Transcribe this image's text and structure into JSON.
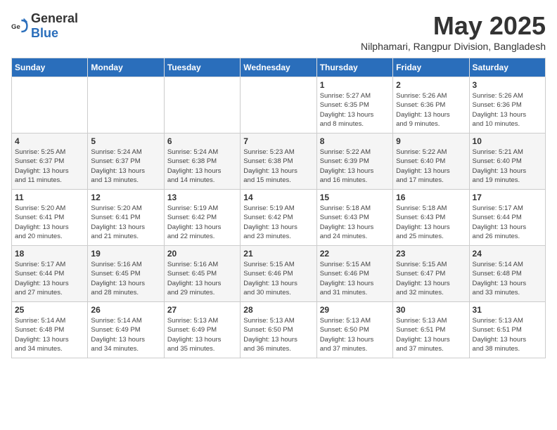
{
  "logo": {
    "general": "General",
    "blue": "Blue"
  },
  "title": "May 2025",
  "subtitle": "Nilphamari, Rangpur Division, Bangladesh",
  "weekdays": [
    "Sunday",
    "Monday",
    "Tuesday",
    "Wednesday",
    "Thursday",
    "Friday",
    "Saturday"
  ],
  "weeks": [
    [
      {
        "day": "",
        "info": ""
      },
      {
        "day": "",
        "info": ""
      },
      {
        "day": "",
        "info": ""
      },
      {
        "day": "",
        "info": ""
      },
      {
        "day": "1",
        "info": "Sunrise: 5:27 AM\nSunset: 6:35 PM\nDaylight: 13 hours\nand 8 minutes."
      },
      {
        "day": "2",
        "info": "Sunrise: 5:26 AM\nSunset: 6:36 PM\nDaylight: 13 hours\nand 9 minutes."
      },
      {
        "day": "3",
        "info": "Sunrise: 5:26 AM\nSunset: 6:36 PM\nDaylight: 13 hours\nand 10 minutes."
      }
    ],
    [
      {
        "day": "4",
        "info": "Sunrise: 5:25 AM\nSunset: 6:37 PM\nDaylight: 13 hours\nand 11 minutes."
      },
      {
        "day": "5",
        "info": "Sunrise: 5:24 AM\nSunset: 6:37 PM\nDaylight: 13 hours\nand 13 minutes."
      },
      {
        "day": "6",
        "info": "Sunrise: 5:24 AM\nSunset: 6:38 PM\nDaylight: 13 hours\nand 14 minutes."
      },
      {
        "day": "7",
        "info": "Sunrise: 5:23 AM\nSunset: 6:38 PM\nDaylight: 13 hours\nand 15 minutes."
      },
      {
        "day": "8",
        "info": "Sunrise: 5:22 AM\nSunset: 6:39 PM\nDaylight: 13 hours\nand 16 minutes."
      },
      {
        "day": "9",
        "info": "Sunrise: 5:22 AM\nSunset: 6:40 PM\nDaylight: 13 hours\nand 17 minutes."
      },
      {
        "day": "10",
        "info": "Sunrise: 5:21 AM\nSunset: 6:40 PM\nDaylight: 13 hours\nand 19 minutes."
      }
    ],
    [
      {
        "day": "11",
        "info": "Sunrise: 5:20 AM\nSunset: 6:41 PM\nDaylight: 13 hours\nand 20 minutes."
      },
      {
        "day": "12",
        "info": "Sunrise: 5:20 AM\nSunset: 6:41 PM\nDaylight: 13 hours\nand 21 minutes."
      },
      {
        "day": "13",
        "info": "Sunrise: 5:19 AM\nSunset: 6:42 PM\nDaylight: 13 hours\nand 22 minutes."
      },
      {
        "day": "14",
        "info": "Sunrise: 5:19 AM\nSunset: 6:42 PM\nDaylight: 13 hours\nand 23 minutes."
      },
      {
        "day": "15",
        "info": "Sunrise: 5:18 AM\nSunset: 6:43 PM\nDaylight: 13 hours\nand 24 minutes."
      },
      {
        "day": "16",
        "info": "Sunrise: 5:18 AM\nSunset: 6:43 PM\nDaylight: 13 hours\nand 25 minutes."
      },
      {
        "day": "17",
        "info": "Sunrise: 5:17 AM\nSunset: 6:44 PM\nDaylight: 13 hours\nand 26 minutes."
      }
    ],
    [
      {
        "day": "18",
        "info": "Sunrise: 5:17 AM\nSunset: 6:44 PM\nDaylight: 13 hours\nand 27 minutes."
      },
      {
        "day": "19",
        "info": "Sunrise: 5:16 AM\nSunset: 6:45 PM\nDaylight: 13 hours\nand 28 minutes."
      },
      {
        "day": "20",
        "info": "Sunrise: 5:16 AM\nSunset: 6:45 PM\nDaylight: 13 hours\nand 29 minutes."
      },
      {
        "day": "21",
        "info": "Sunrise: 5:15 AM\nSunset: 6:46 PM\nDaylight: 13 hours\nand 30 minutes."
      },
      {
        "day": "22",
        "info": "Sunrise: 5:15 AM\nSunset: 6:46 PM\nDaylight: 13 hours\nand 31 minutes."
      },
      {
        "day": "23",
        "info": "Sunrise: 5:15 AM\nSunset: 6:47 PM\nDaylight: 13 hours\nand 32 minutes."
      },
      {
        "day": "24",
        "info": "Sunrise: 5:14 AM\nSunset: 6:48 PM\nDaylight: 13 hours\nand 33 minutes."
      }
    ],
    [
      {
        "day": "25",
        "info": "Sunrise: 5:14 AM\nSunset: 6:48 PM\nDaylight: 13 hours\nand 34 minutes."
      },
      {
        "day": "26",
        "info": "Sunrise: 5:14 AM\nSunset: 6:49 PM\nDaylight: 13 hours\nand 34 minutes."
      },
      {
        "day": "27",
        "info": "Sunrise: 5:13 AM\nSunset: 6:49 PM\nDaylight: 13 hours\nand 35 minutes."
      },
      {
        "day": "28",
        "info": "Sunrise: 5:13 AM\nSunset: 6:50 PM\nDaylight: 13 hours\nand 36 minutes."
      },
      {
        "day": "29",
        "info": "Sunrise: 5:13 AM\nSunset: 6:50 PM\nDaylight: 13 hours\nand 37 minutes."
      },
      {
        "day": "30",
        "info": "Sunrise: 5:13 AM\nSunset: 6:51 PM\nDaylight: 13 hours\nand 37 minutes."
      },
      {
        "day": "31",
        "info": "Sunrise: 5:13 AM\nSunset: 6:51 PM\nDaylight: 13 hours\nand 38 minutes."
      }
    ]
  ]
}
